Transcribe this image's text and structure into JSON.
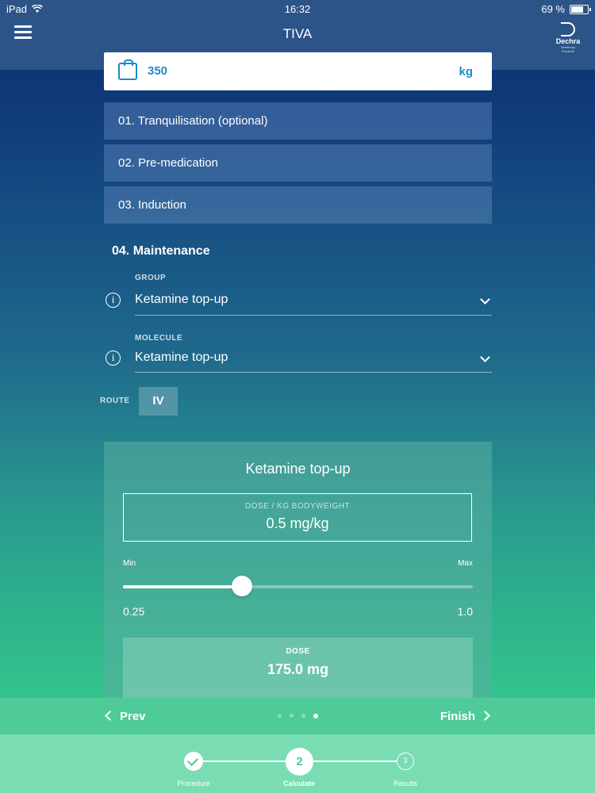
{
  "status": {
    "device": "iPad",
    "time": "16:32",
    "battery": "69 %"
  },
  "header": {
    "title": "TIVA",
    "logo_text": "Dechra",
    "logo_sub": "Veterinary Products"
  },
  "weight": {
    "value": "350",
    "unit": "kg"
  },
  "steps": [
    {
      "label": "01. Tranquilisation (optional)"
    },
    {
      "label": "02. Pre-medication"
    },
    {
      "label": "03. Induction"
    }
  ],
  "maintenance": {
    "title": "04. Maintenance",
    "group_label": "GROUP",
    "group_value": "Ketamine top-up",
    "molecule_label": "MOLECULE",
    "molecule_value": "Ketamine top-up",
    "route_label": "ROUTE",
    "route_value": "IV"
  },
  "card": {
    "title": "Ketamine top-up",
    "dose_label": "DOSE / KG BODYWEIGHT",
    "dose_value": "0.5 mg/kg",
    "min_label": "Min",
    "max_label": "Max",
    "min_value": "0.25",
    "max_value": "1.0",
    "slider_fraction": 0.34,
    "result_label": "DOSE",
    "result_value": "175.0 mg"
  },
  "nav": {
    "prev": "Prev",
    "finish": "Finish",
    "page_count": 4,
    "current_page": 4
  },
  "stepper": [
    {
      "label": "Procedure",
      "state": "done"
    },
    {
      "label": "Calculate",
      "number": "2",
      "state": "current"
    },
    {
      "label": "Results",
      "number": "3",
      "state": "pending"
    }
  ]
}
